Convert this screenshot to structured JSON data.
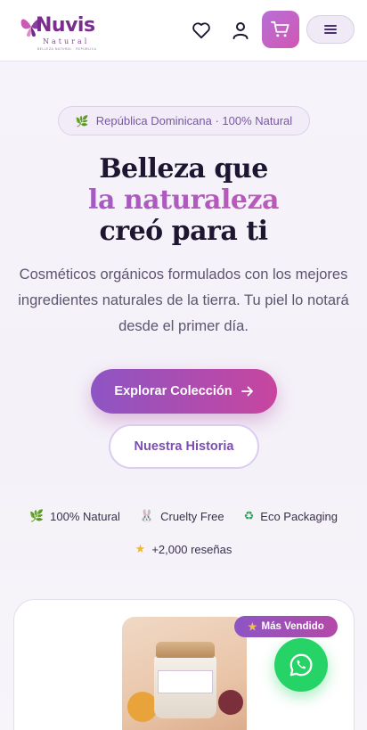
{
  "header": {
    "brand": "Nuvis",
    "brand_sub": "Natural",
    "brand_tagline": "BELLEZA NATURAL · REPUBLICA",
    "icons": {
      "wishlist": "heart-icon",
      "account": "user-icon",
      "cart": "cart-icon",
      "menu": "menu-icon"
    }
  },
  "hero": {
    "badge_icon": "leaf-icon",
    "badge_text": "República Dominicana · 100% Natural",
    "title_line1": "Belleza que",
    "title_line2": "la naturaleza",
    "title_line3": "creó para ti",
    "subtitle": "Cosméticos orgánicos formulados con los mejores ingredientes naturales de la tierra. Tu piel lo notará desde el primer día.",
    "primary_cta": "Explorar Colección",
    "secondary_cta": "Nuestra Historia"
  },
  "features": [
    {
      "icon": "leaf-icon",
      "label": "100% Natural"
    },
    {
      "icon": "rabbit-icon",
      "label": "Cruelty Free"
    },
    {
      "icon": "recycle-icon",
      "label": "Eco Packaging"
    },
    {
      "icon": "star-icon",
      "label": "+2,000 reseñas"
    }
  ],
  "product_card": {
    "badge": "Más Vendido",
    "badge_icon": "star-icon"
  },
  "floating": {
    "whatsapp_icon": "whatsapp-icon"
  },
  "colors": {
    "brand_purple": "#8d55c4",
    "brand_pink": "#c8459f",
    "whatsapp_green": "#25d366",
    "text_dark": "#1e1530"
  }
}
